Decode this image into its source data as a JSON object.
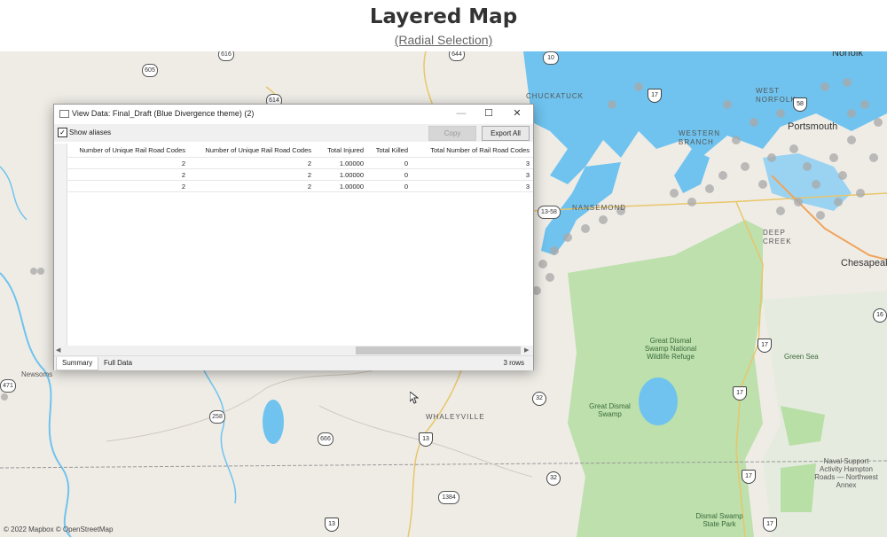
{
  "header": {
    "title": "Layered Map",
    "subtitle": "(Radial Selection)"
  },
  "map": {
    "labels": {
      "chuckatuck": "CHUCKATUCK",
      "western_branch": "WESTERN BRANCH",
      "west_norfolk": "WEST NORFOLK",
      "nansemond": "NANSEMOND",
      "deep_creek": "DEEP CREEK",
      "whaleyville": "WHALEYVILLE",
      "norfolk": "Norfolk",
      "portsmouth": "Portsmouth",
      "chesapeake": "Chesapeak",
      "newsoms": "Newsoms",
      "great_dismal_refuge": "Great Dismal Swamp National Wildlife Refuge",
      "great_dismal_swamp": "Great Dismal Swamp",
      "green_sea": "Green Sea",
      "dismal_state_park": "Dismal Swamp State Park",
      "naval_support": "Naval Support Activity Hampton Roads — Northwest Annex"
    },
    "shields": {
      "s605": "605",
      "s614": "614",
      "s616": "616",
      "s644": "644",
      "s10": "10",
      "s471": "471",
      "s258": "258",
      "s666": "666",
      "s13": "13",
      "s1384": "1384",
      "s32a": "32",
      "s32b": "32",
      "s17a": "17",
      "s17b": "17",
      "s17c": "17",
      "s17d": "17",
      "s17e": "17",
      "s58": "58",
      "s1358": "13-58",
      "s13b": "13",
      "s16": "16"
    },
    "copyright": "© 2022 Mapbox © OpenStreetMap"
  },
  "dialog": {
    "title": "View Data: Final_Draft (Blue Divergence theme) (2)",
    "minimize": "—",
    "maximize": "☐",
    "close": "✕",
    "show_aliases_label": "Show aliases",
    "show_aliases_checked": "✓",
    "copy_label": "Copy",
    "export_label": "Export All",
    "columns": [
      "Number of Unique Rail Road Codes",
      "Number of Unique Rail Road Codes",
      "Total Injured",
      "Total Killed",
      "Total Number of Rail Road Codes"
    ],
    "rows": [
      [
        "2",
        "2",
        "1.00000",
        "0",
        "3"
      ],
      [
        "2",
        "2",
        "1.00000",
        "0",
        "3"
      ],
      [
        "2",
        "2",
        "1.00000",
        "0",
        "3"
      ]
    ],
    "tabs": [
      "Summary",
      "Full Data"
    ],
    "row_count": "3 rows",
    "scroll_left": "◀",
    "scroll_right": "▶"
  }
}
